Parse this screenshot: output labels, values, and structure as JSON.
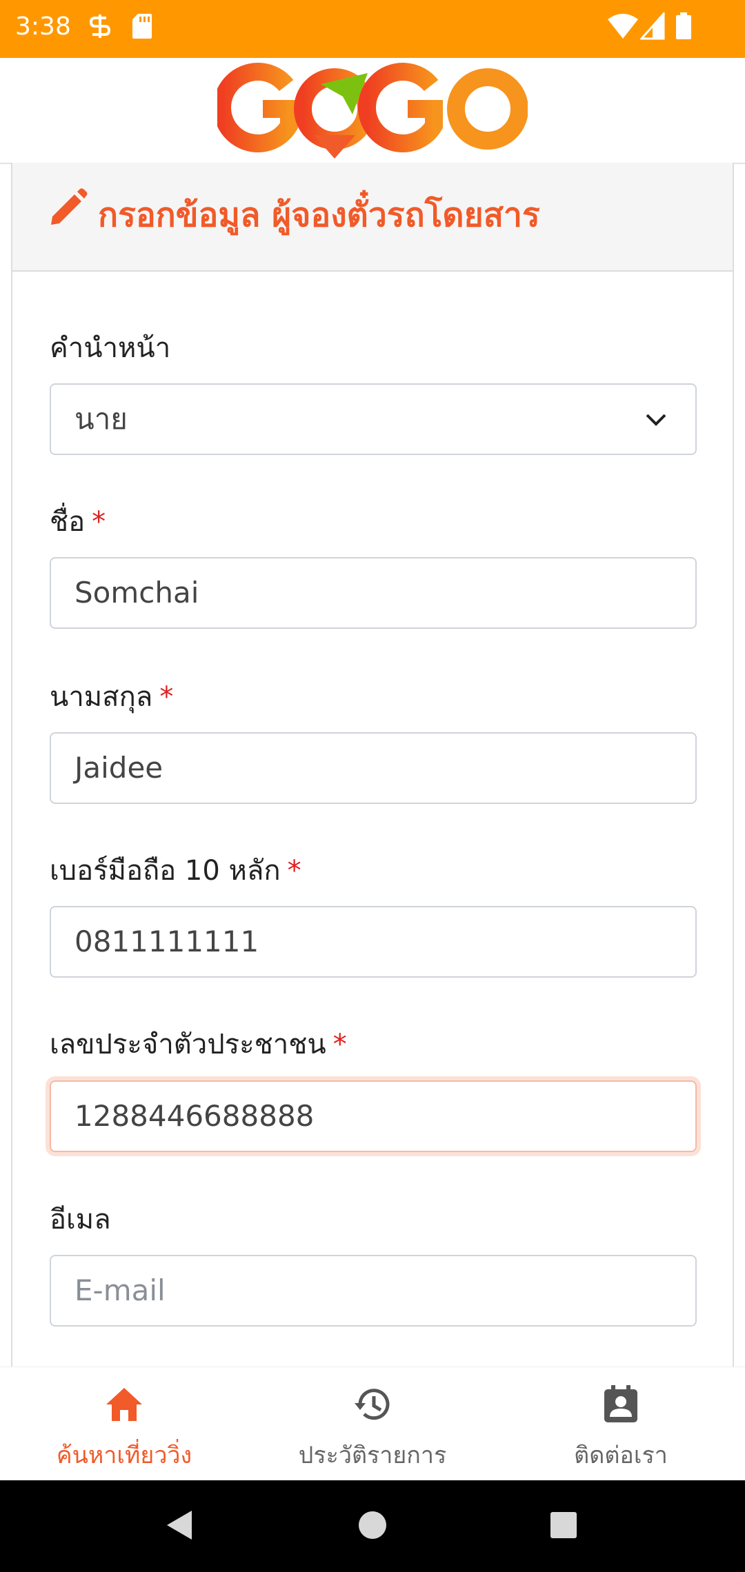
{
  "status_bar": {
    "time": "3:38",
    "icons": [
      "s-icon",
      "sd-card-icon",
      "wifi-icon",
      "signal-icon",
      "battery-icon"
    ]
  },
  "header": {
    "logo_text": "GOGO",
    "brand_colors": {
      "orange": "#f15a29",
      "green": "#7cc110"
    }
  },
  "form": {
    "title": "กรอกข้อมูล ผู้จองตั๋วรถโดยสาร",
    "title_icon": "pencil-icon",
    "required_mark": "*",
    "prefix": {
      "label": "คำนำหน้า",
      "value": "นาย"
    },
    "first_name": {
      "label": "ชื่อ",
      "value": "Somchai"
    },
    "last_name": {
      "label": "นามสกุล",
      "value": "Jaidee"
    },
    "phone": {
      "label": "เบอร์มือถือ 10 หลัก",
      "value": "0811111111"
    },
    "national_id": {
      "label": "เลขประจำตัวประชาชน",
      "value": "1288446688888"
    },
    "email": {
      "label": "อีเมล",
      "placeholder": "E-mail"
    }
  },
  "bottom_nav": {
    "items": [
      {
        "label": "ค้นหาเที่ยววิ่ง",
        "icon": "home-icon",
        "active": true
      },
      {
        "label": "ประวัติรายการ",
        "icon": "history-icon",
        "active": false
      },
      {
        "label": "ติดต่อเรา",
        "icon": "contact-icon",
        "active": false
      }
    ]
  },
  "colors": {
    "status_bar": "#ff9800",
    "accent": "#f15a29",
    "required": "#e02020"
  }
}
